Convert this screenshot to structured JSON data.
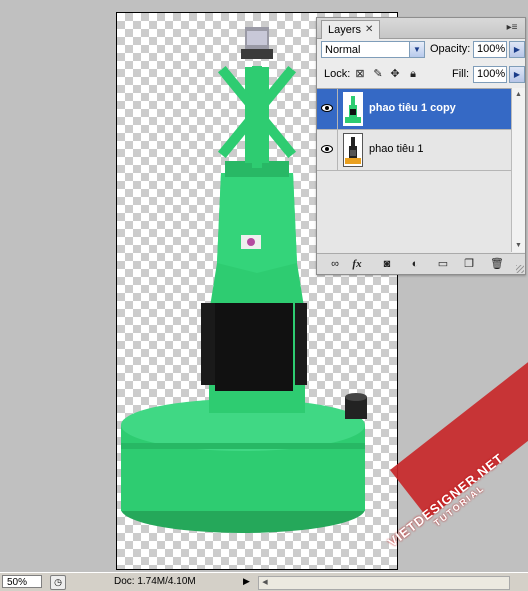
{
  "layers_panel": {
    "tab_label": "Layers",
    "blend_mode": "Normal",
    "opacity_label": "Opacity:",
    "opacity_value": "100%",
    "lock_label": "Lock:",
    "fill_label": "Fill:",
    "fill_value": "100%",
    "layers": [
      {
        "name": "phao tiêu 1 copy",
        "selected": true,
        "visible": true
      },
      {
        "name": "phao tiêu 1",
        "selected": false,
        "visible": true
      }
    ],
    "footer_icons": [
      "link-icon",
      "fx-icon",
      "mask-icon",
      "adjustment-icon",
      "folder-icon",
      "new-layer-icon",
      "trash-icon"
    ]
  },
  "status_bar": {
    "zoom": "50%",
    "doc_info": "Doc: 1.74M/4.10M"
  },
  "watermark": {
    "line1": "VIETDESIGNER.NET",
    "line2": "TUTORIAL"
  },
  "colors": {
    "selection_blue": "#3569c5",
    "buoy_green": "#2ecc71",
    "watermark_red": "#c8282a"
  }
}
